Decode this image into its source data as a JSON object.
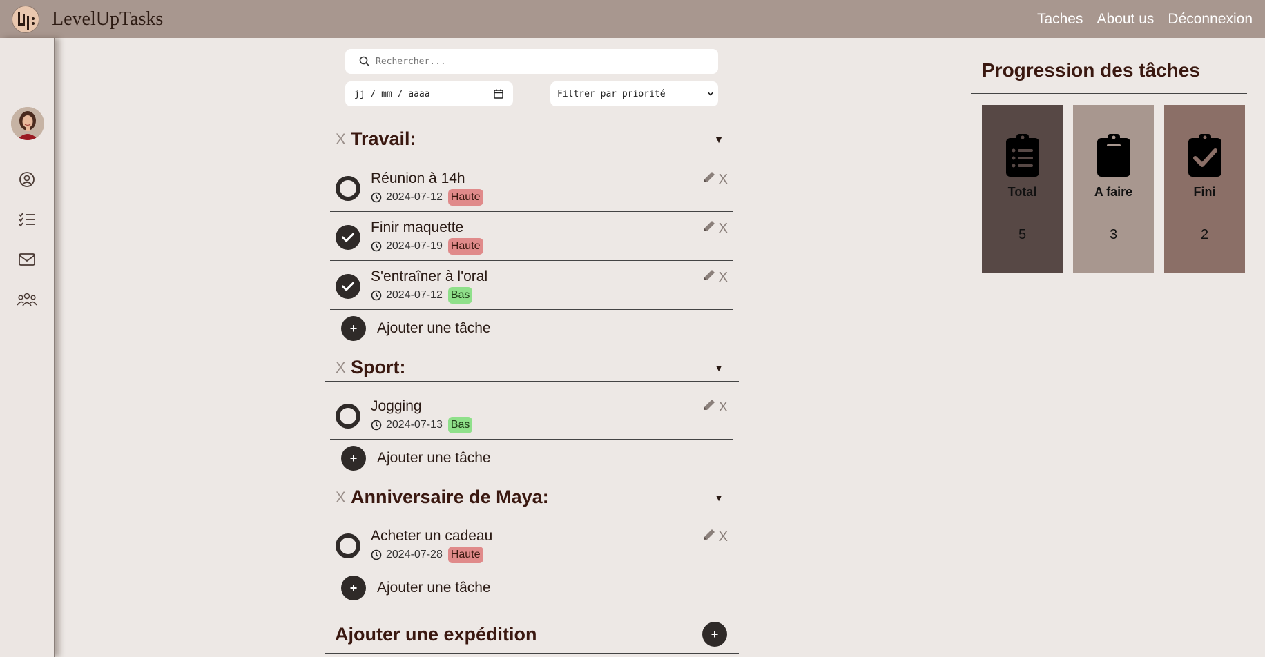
{
  "app": {
    "title": "LevelUpTasks"
  },
  "nav": [
    "Taches",
    "About us",
    "Déconnexion"
  ],
  "search": {
    "placeholder": "Rechercher..."
  },
  "date_filter": {
    "placeholder": "jj / mm / aaaa"
  },
  "priority_filter": {
    "selected": "Filtrer par priorité"
  },
  "groups": [
    {
      "delete_label": "X",
      "title": "Travail:",
      "tasks": [
        {
          "title": "Réunion à 14h",
          "date": "2024-07-12",
          "priority": "Haute",
          "done": false
        },
        {
          "title": "Finir maquette",
          "date": "2024-07-19",
          "priority": "Haute",
          "done": true
        },
        {
          "title": "S'entraîner à l'oral",
          "date": "2024-07-12",
          "priority": "Bas",
          "done": true
        }
      ],
      "add_label": "Ajouter une tâche"
    },
    {
      "delete_label": "X",
      "title": "Sport:",
      "tasks": [
        {
          "title": "Jogging",
          "date": "2024-07-13",
          "priority": "Bas",
          "done": false
        }
      ],
      "add_label": "Ajouter une tâche"
    },
    {
      "delete_label": "X",
      "title": "Anniversaire de Maya:",
      "tasks": [
        {
          "title": "Acheter un cadeau",
          "date": "2024-07-28",
          "priority": "Haute",
          "done": false
        }
      ],
      "add_label": "Ajouter une tâche"
    }
  ],
  "add_expedition": {
    "label": "Ajouter une expédition",
    "button": "+"
  },
  "task_delete_label": "X",
  "add_button_symbol": "+",
  "progress": {
    "title": "Progression des tâches",
    "cards": [
      {
        "label": "Total",
        "value": "5",
        "color": "#574845"
      },
      {
        "label": "A faire",
        "value": "3",
        "color": "#a8978f"
      },
      {
        "label": "Fini",
        "value": "2",
        "color": "#8b6f67"
      }
    ]
  },
  "colors": {
    "topbar": "#a8978f",
    "background": "#ede8e5",
    "heading": "#3a1810",
    "priority_high": "#e08a8a",
    "priority_low": "#8fe08a"
  }
}
